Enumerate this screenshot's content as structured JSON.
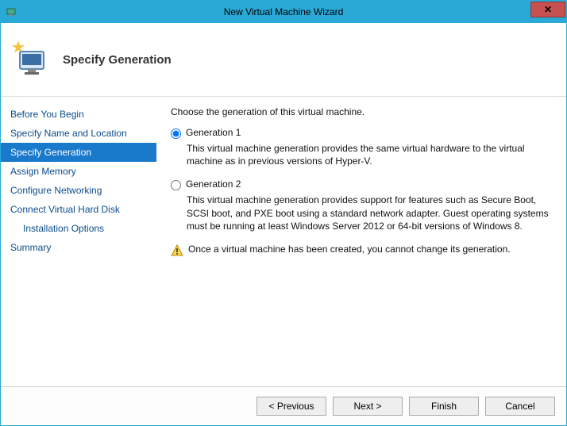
{
  "window": {
    "title": "New Virtual Machine Wizard",
    "close_aria": "Close"
  },
  "header": {
    "heading": "Specify Generation"
  },
  "sidebar": {
    "steps": [
      {
        "label": "Before You Begin"
      },
      {
        "label": "Specify Name and Location"
      },
      {
        "label": "Specify Generation"
      },
      {
        "label": "Assign Memory"
      },
      {
        "label": "Configure Networking"
      },
      {
        "label": "Connect Virtual Hard Disk"
      },
      {
        "label": "Installation Options"
      },
      {
        "label": "Summary"
      }
    ]
  },
  "content": {
    "instruction": "Choose the generation of this virtual machine.",
    "gen1_label": "Generation 1",
    "gen1_desc": "This virtual machine generation provides the same virtual hardware to the virtual machine as in previous versions of Hyper-V.",
    "gen2_label": "Generation 2",
    "gen2_desc": "This virtual machine generation provides support for features such as Secure Boot, SCSI boot, and PXE boot using a standard network adapter. Guest operating systems must be running at least Windows Server 2012 or 64-bit versions of Windows 8.",
    "warning": "Once a virtual machine has been created, you cannot change its generation."
  },
  "footer": {
    "previous": "< Previous",
    "next": "Next >",
    "finish": "Finish",
    "cancel": "Cancel"
  }
}
